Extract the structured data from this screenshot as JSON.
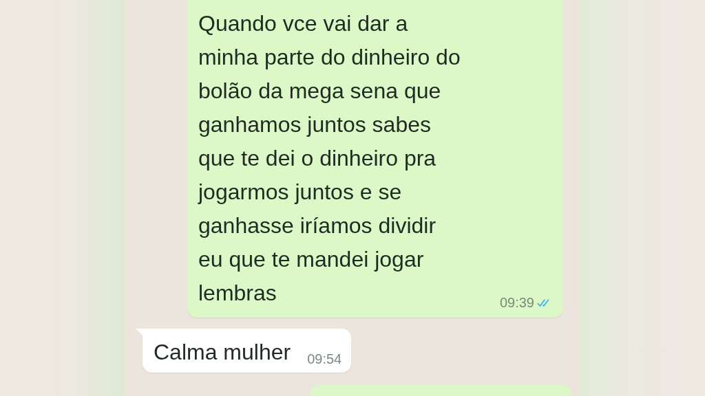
{
  "messages": [
    {
      "kind": "out",
      "text": "Quando vce vai dar a\nminha parte do dinheiro do\nbolão da mega sena que\nganhamos juntos sabes\nque te dei o dinheiro pra\njogarmos juntos e se\nganhasse iríamos dividir\neu que te mandei jogar\nlembras",
      "time": "09:39",
      "read": true
    },
    {
      "kind": "in",
      "text": "Calma mulher",
      "time": "09:54"
    },
    {
      "kind": "out"
    }
  ]
}
